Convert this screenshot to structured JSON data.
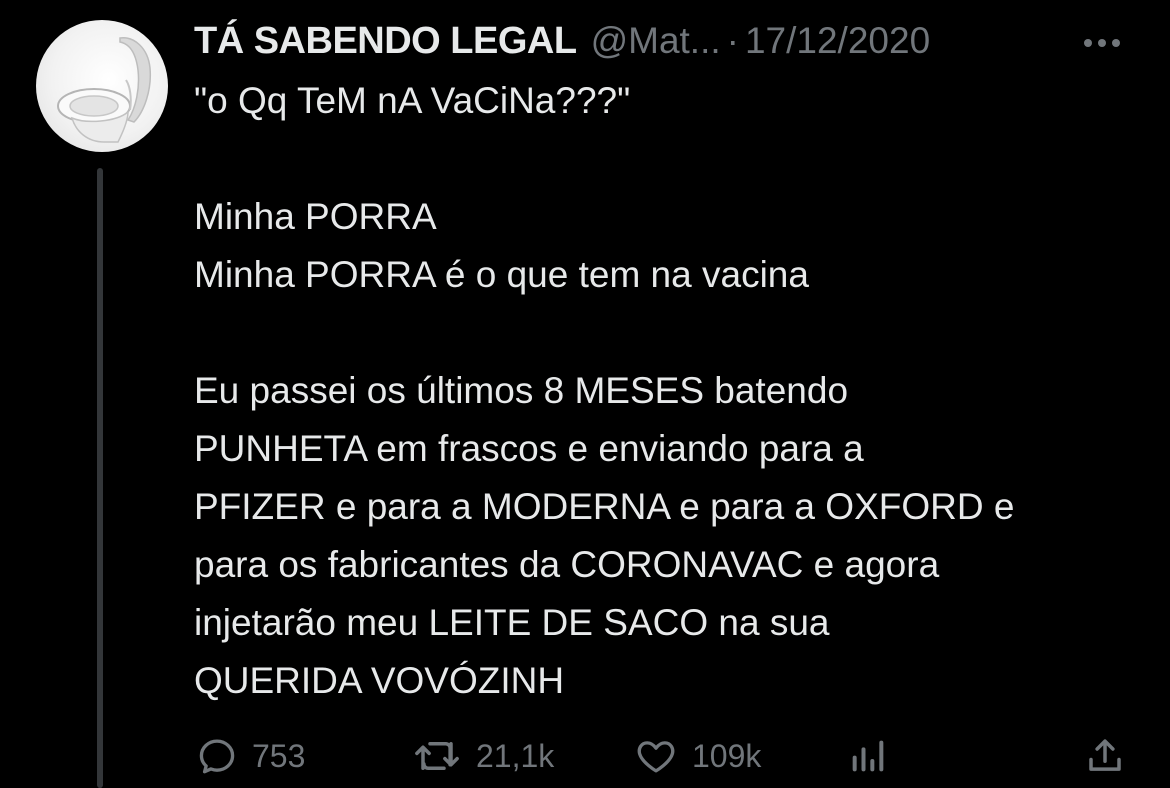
{
  "tweet": {
    "author": {
      "display_name": "TÁ SABENDO LEGAL",
      "handle": "@Mat...",
      "separator": "·",
      "avatar_icon": "toilet-icon"
    },
    "date": "17/12/2020",
    "more_icon": "more-dots-icon",
    "lines": [
      "\"o Qq TeM nA VaCiNa???\"",
      "",
      "Minha PORRA",
      "Minha PORRA é o que tem na vacina",
      "",
      "Eu passei os últimos 8 MESES batendo",
      "PUNHETA em frascos e enviando para a",
      "PFIZER e para a MODERNA e para a OXFORD e",
      "para os fabricantes da CORONAVAC e agora",
      "injetarão meu LEITE DE SACO na sua",
      "QUERIDA VOVÓZINH"
    ],
    "actions": {
      "reply": {
        "icon": "reply-icon",
        "count": "753"
      },
      "retweet": {
        "icon": "retweet-icon",
        "count": "21,1k"
      },
      "like": {
        "icon": "heart-icon",
        "count": "109k"
      },
      "views": {
        "icon": "views-icon"
      },
      "share": {
        "icon": "share-icon"
      }
    }
  },
  "colors": {
    "background": "#000000",
    "text_primary": "#e7e9ea",
    "text_secondary": "#71767b",
    "thread_line": "#333639"
  }
}
